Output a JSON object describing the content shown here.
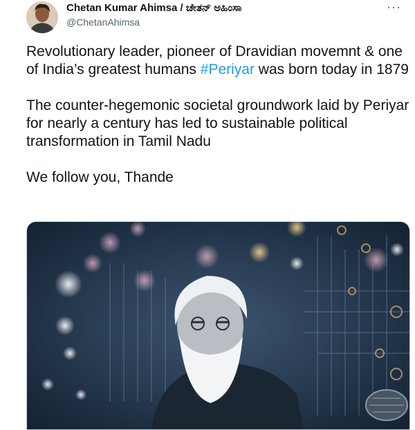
{
  "tweet": {
    "author_name": "Chetan Kumar Ahimsa / ಚೇತನ್ ಅಹಿಂಸಾ",
    "author_handle": "@ChetanAhimsa",
    "more_icon": "more-horizontal-icon",
    "text_part1": "Revolutionary leader, pioneer of Dravidian movemnt & one of India’s greatest humans ",
    "hashtag": "#Periyar",
    "text_part2": " was born today in 1879\n\nThe counter-hegemonic societal groundwork laid by Periyar for nearly a century has led to sustainable political transformation in Tamil Nadu\n\nWe follow you, Thande"
  },
  "colors": {
    "link": "#1d9bf0",
    "text": "#0f1419",
    "muted": "#536471"
  }
}
